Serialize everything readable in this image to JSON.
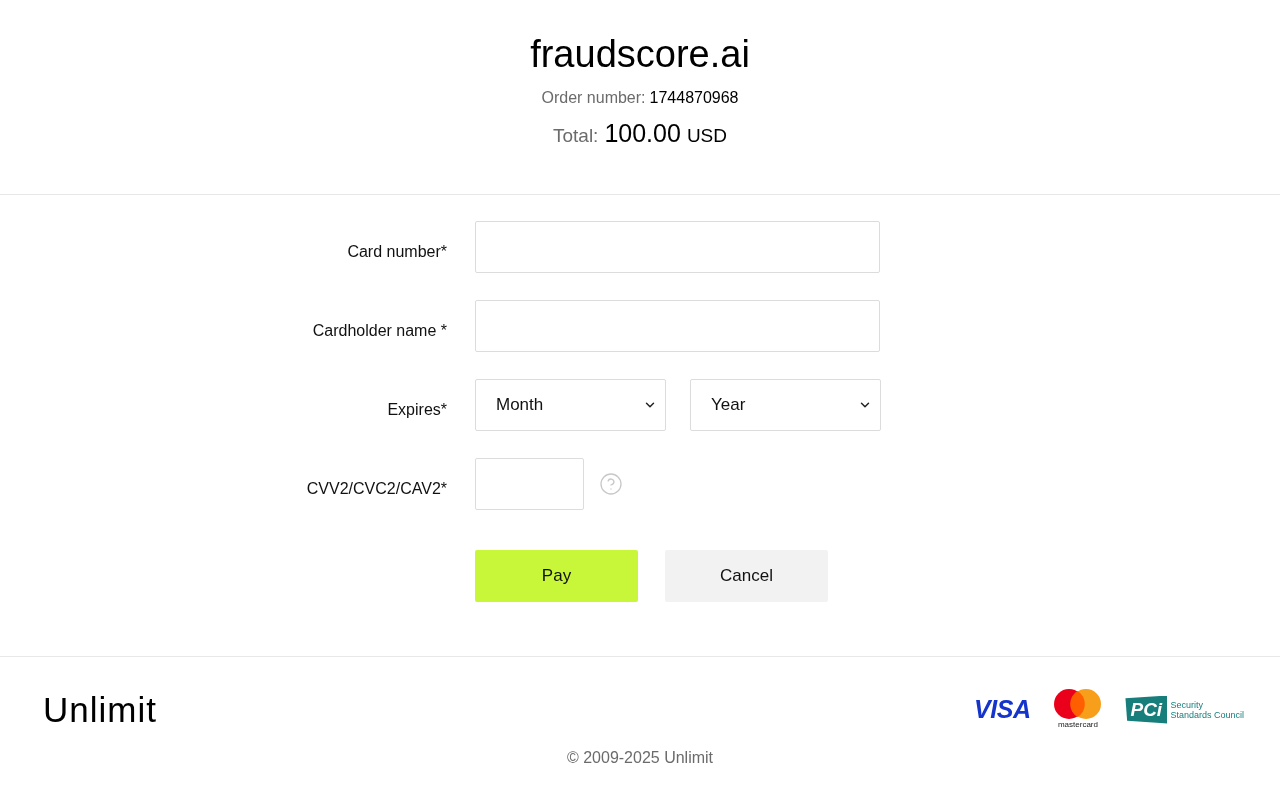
{
  "header": {
    "merchant": "fraudscore.ai",
    "order": {
      "label": "Order number:",
      "value": "1744870968"
    },
    "total": {
      "label": "Total:",
      "amount": "100.00",
      "currency": "USD"
    }
  },
  "form": {
    "fields": [
      {
        "kind": "text",
        "label": "Card number*"
      },
      {
        "kind": "text",
        "label": "Cardholder name *"
      },
      {
        "kind": "select_pair",
        "label": "Expires*",
        "selects": [
          {
            "value": "Month"
          },
          {
            "value": "Year"
          }
        ]
      },
      {
        "kind": "cvv",
        "label": "CVV2/CVC2/CAV2*"
      }
    ],
    "buttons": [
      {
        "kind": "primary",
        "label": "Pay"
      },
      {
        "kind": "secondary",
        "label": "Cancel"
      }
    ]
  },
  "footer": {
    "logo": "Unlimit",
    "payment_logos": [
      {
        "kind": "visa",
        "text": "VISA"
      },
      {
        "kind": "mastercard",
        "text": "mastercard"
      },
      {
        "kind": "pci",
        "text": "PCi",
        "caption": [
          "Security",
          "Standards Council"
        ]
      }
    ],
    "copyright": "© 2009-2025 Unlimit"
  }
}
